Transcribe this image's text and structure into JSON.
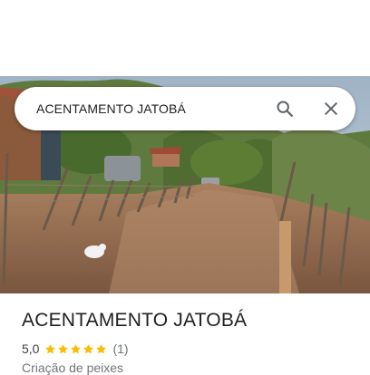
{
  "search": {
    "value": "ACENTAMENTO JATOBÁ",
    "search_icon": "search-icon",
    "clear_icon": "close-icon"
  },
  "place": {
    "title": "ACENTAMENTO JATOBÁ",
    "rating": "5,0",
    "stars": 5,
    "review_count": "(1)",
    "category": "Criação de peixes"
  },
  "colors": {
    "star": "#fbbc04",
    "title_text": "#202124",
    "secondary_text": "#70757a",
    "icon": "#5f6368"
  }
}
